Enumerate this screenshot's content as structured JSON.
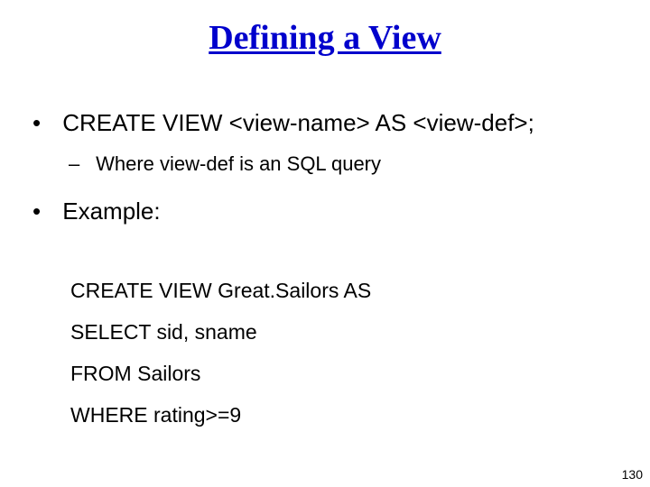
{
  "title": "Defining a View",
  "bullets": {
    "b1": "CREATE VIEW <view-name> AS <view-def>;",
    "b2": "Where view-def is an SQL query",
    "b3": "Example:"
  },
  "example": {
    "line1": "CREATE VIEW Great.Sailors AS",
    "line2": "SELECT sid, sname",
    "line3": "FROM Sailors",
    "line4": "WHERE rating>=9"
  },
  "page_number": "130"
}
